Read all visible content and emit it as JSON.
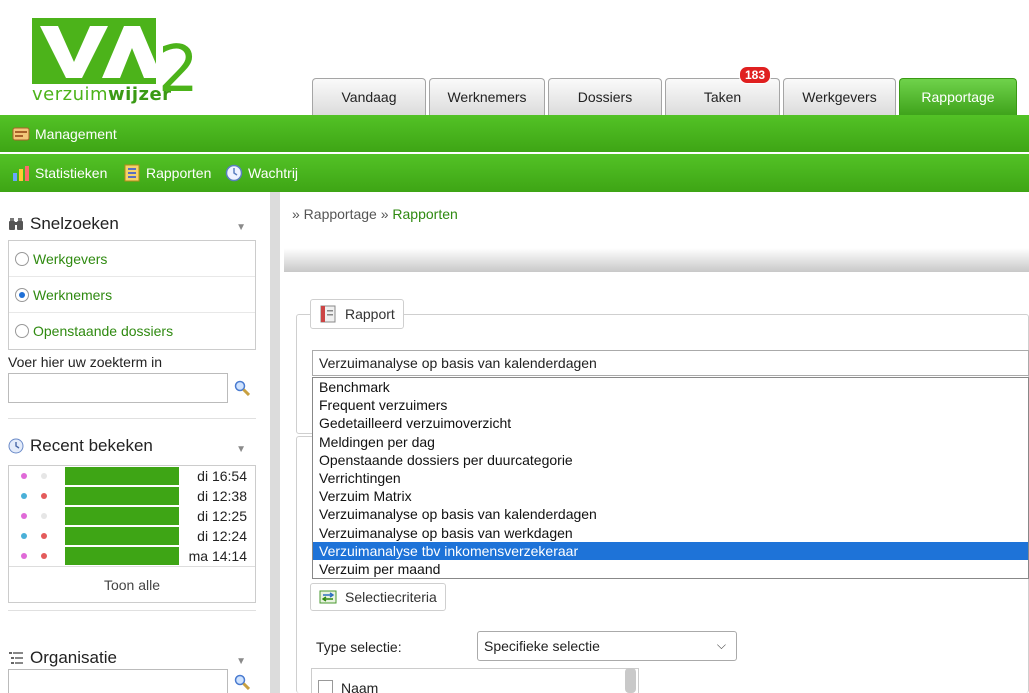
{
  "logo": {
    "mark": "VA",
    "text_prefix": "verzuim",
    "text_bold": "wijzer",
    "version": "2"
  },
  "tabs": [
    {
      "label": "Vandaag",
      "width": 114
    },
    {
      "label": "Werknemers",
      "width": 116
    },
    {
      "label": "Dossiers",
      "width": 114
    },
    {
      "label": "Taken",
      "width": 115,
      "badge": "183"
    },
    {
      "label": "Werkgevers",
      "width": 113
    },
    {
      "label": "Rapportage",
      "width": 118,
      "active": true
    }
  ],
  "bar1": {
    "label": "Management"
  },
  "bar2": {
    "statistieken": "Statistieken",
    "rapporten": "Rapporten",
    "wachtrij": "Wachtrij"
  },
  "sidebar": {
    "snelzoeken": {
      "title": "Snelzoeken",
      "options": [
        "Werkgevers",
        "Werknemers",
        "Openstaande dossiers"
      ],
      "selected": 1
    },
    "search_label": "Voer hier uw zoekterm in",
    "recent": {
      "title": "Recent bekeken",
      "rows": [
        {
          "time": "di 16:54",
          "dot2": "#e6e6e6"
        },
        {
          "time": "di 12:38",
          "dot2": "#e35b5b"
        },
        {
          "time": "di 12:25",
          "dot2": "#e6e6e6"
        },
        {
          "time": "di 12:24",
          "dot2": "#e35b5b"
        },
        {
          "time": "ma 14:14",
          "dot2": "#e35b5b"
        }
      ],
      "toon_alle": "Toon alle"
    },
    "organisatie": {
      "title": "Organisatie"
    }
  },
  "breadcrumb": {
    "prefix": "» Rapportage » ",
    "current": "Rapporten"
  },
  "rapport": {
    "legend": "Rapport",
    "selected_value": "Verzuimanalyse op basis van kalenderdagen",
    "options": [
      "Benchmark",
      "Frequent verzuimers",
      "Gedetailleerd verzuimoverzicht",
      "Meldingen per dag",
      "Openstaande dossiers per duurcategorie",
      "Verrichtingen",
      "Verzuim Matrix",
      "Verzuimanalyse op basis van kalenderdagen",
      "Verzuimanalyse op basis van werkdagen",
      "Verzuimanalyse tbv inkomensverzekeraar",
      "Verzuim per maand"
    ],
    "highlighted_index": 9
  },
  "selectiecriteria": {
    "legend": "Selectiecriteria",
    "type_label": "Type selectie:",
    "type_value": "Specifieke selectie",
    "naam_label": "Naam"
  },
  "colors": {
    "brand_green": "#4cb31a",
    "link_green": "#2f8a10",
    "highlight_blue": "#1e73d8",
    "badge_red": "#e02020"
  }
}
